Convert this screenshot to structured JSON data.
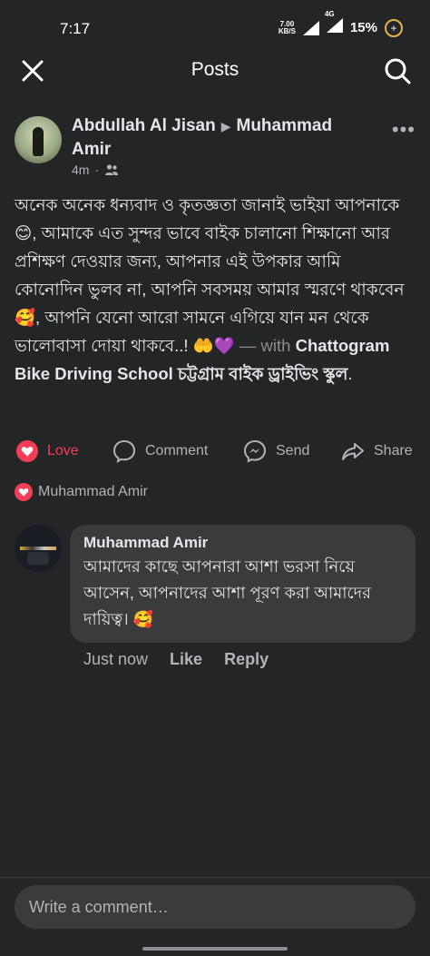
{
  "status_bar": {
    "time": "7:17",
    "net_speed_value": "7.00",
    "net_speed_unit": "KB/S",
    "network": "4G",
    "battery": "15%"
  },
  "header": {
    "title": "Posts",
    "close_icon": "close-icon",
    "search_icon": "search-icon"
  },
  "post": {
    "author": "Abdullah Al Jisan",
    "recipient": "Muhammad Amir",
    "time": "4m",
    "audience_icon": "friends-icon",
    "text": "অনেক অনেক ধন্যবাদ ও কৃতজ্ঞতা জানাই ভাইয়া আপনাকে 😊, আমাকে এত সুন্দর ভাবে বাইক চালানো শিক্ষানো আর প্রশিক্ষণ দেওয়ার জন্য, আপনার এই উপকার আমি কোনোদিন ভুলব না, আপনি সবসময় আমার স্মরণে থাকবেন 🥰, আপনি যেনো আরো সামনে এগিয়ে যান মন থেকে ভালোবাসা দোয়া থাকবে..! 🤲💜",
    "with_text": "— with",
    "place": "Chattogram Bike Driving School চট্টগ্রাম বাইক ড্রাইভিং স্কুল",
    "place_end": "."
  },
  "actions": {
    "love": "Love",
    "comment": "Comment",
    "send": "Send",
    "share": "Share"
  },
  "reactions": {
    "name": "Muhammad Amir"
  },
  "comment": {
    "author": "Muhammad Amir",
    "text": "আমাদের কাছে আপনারা আশা ভরসা নিয়ে আসেন, আপনাদের আশা পূরণ করা আমাদের দায়িত্ব। 🥰",
    "time": "Just now",
    "like": "Like",
    "reply": "Reply"
  },
  "composer": {
    "placeholder": "Write a comment…"
  },
  "colors": {
    "background": "#242526",
    "love": "#f33e58",
    "bubble": "#3a3b3c",
    "muted": "#b0b3b8"
  }
}
